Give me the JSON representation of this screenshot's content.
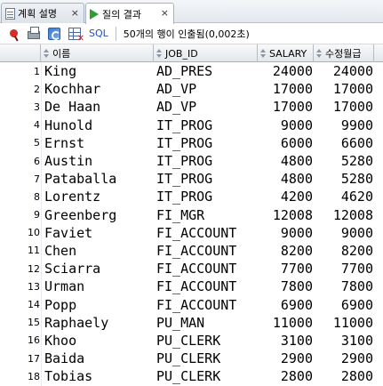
{
  "tabs": [
    {
      "label": "계획 설명",
      "close": "×"
    },
    {
      "label": "질의 결과",
      "close": "×"
    }
  ],
  "toolbar": {
    "sql_label": "SQL",
    "status": "50개의 행이 인출됨(0,002초)"
  },
  "columns": {
    "name": "이름",
    "job": "JOB_ID",
    "salary": "SALARY",
    "adjusted": "수정월급"
  },
  "rows": [
    {
      "n": "1",
      "name": "King",
      "job": "AD_PRES",
      "salary": "24000",
      "adjusted": "24000"
    },
    {
      "n": "2",
      "name": "Kochhar",
      "job": "AD_VP",
      "salary": "17000",
      "adjusted": "17000"
    },
    {
      "n": "3",
      "name": "De Haan",
      "job": "AD_VP",
      "salary": "17000",
      "adjusted": "17000"
    },
    {
      "n": "4",
      "name": "Hunold",
      "job": "IT_PROG",
      "salary": "9000",
      "adjusted": "9900"
    },
    {
      "n": "5",
      "name": "Ernst",
      "job": "IT_PROG",
      "salary": "6000",
      "adjusted": "6600"
    },
    {
      "n": "6",
      "name": "Austin",
      "job": "IT_PROG",
      "salary": "4800",
      "adjusted": "5280"
    },
    {
      "n": "7",
      "name": "Pataballa",
      "job": "IT_PROG",
      "salary": "4800",
      "adjusted": "5280"
    },
    {
      "n": "8",
      "name": "Lorentz",
      "job": "IT_PROG",
      "salary": "4200",
      "adjusted": "4620"
    },
    {
      "n": "9",
      "name": "Greenberg",
      "job": "FI_MGR",
      "salary": "12008",
      "adjusted": "12008"
    },
    {
      "n": "10",
      "name": "Faviet",
      "job": "FI_ACCOUNT",
      "salary": "9000",
      "adjusted": "9000"
    },
    {
      "n": "11",
      "name": "Chen",
      "job": "FI_ACCOUNT",
      "salary": "8200",
      "adjusted": "8200"
    },
    {
      "n": "12",
      "name": "Sciarra",
      "job": "FI_ACCOUNT",
      "salary": "7700",
      "adjusted": "7700"
    },
    {
      "n": "13",
      "name": "Urman",
      "job": "FI_ACCOUNT",
      "salary": "7800",
      "adjusted": "7800"
    },
    {
      "n": "14",
      "name": "Popp",
      "job": "FI_ACCOUNT",
      "salary": "6900",
      "adjusted": "6900"
    },
    {
      "n": "15",
      "name": "Raphaely",
      "job": "PU_MAN",
      "salary": "11000",
      "adjusted": "11000"
    },
    {
      "n": "16",
      "name": "Khoo",
      "job": "PU_CLERK",
      "salary": "3100",
      "adjusted": "3100"
    },
    {
      "n": "17",
      "name": "Baida",
      "job": "PU_CLERK",
      "salary": "2900",
      "adjusted": "2900"
    },
    {
      "n": "18",
      "name": "Tobias",
      "job": "PU_CLERK",
      "salary": "2800",
      "adjusted": "2800"
    }
  ]
}
